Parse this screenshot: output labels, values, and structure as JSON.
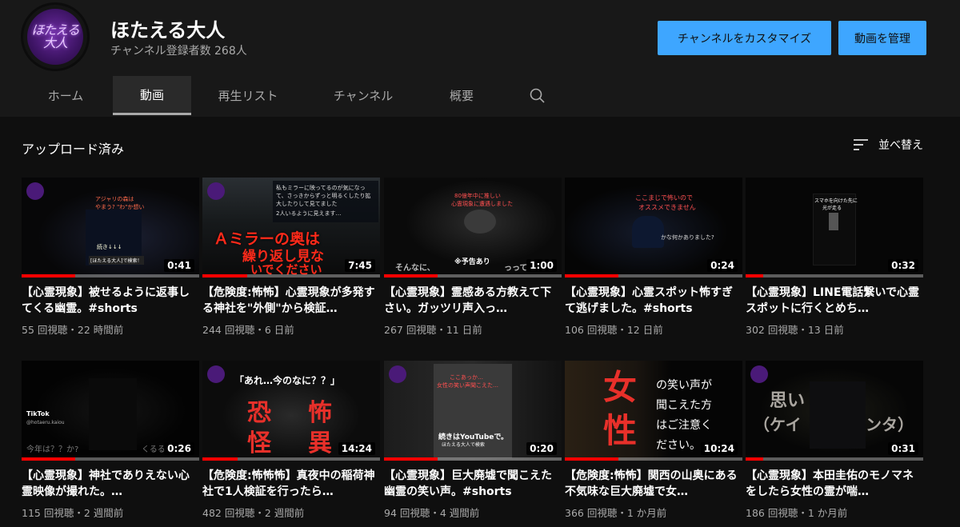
{
  "channel": {
    "avatar_text": "ほたえる大人",
    "name": "ほたえる大人",
    "subscribers": "チャンネル登録者数 268人"
  },
  "buttons": {
    "customize": "チャンネルをカスタマイズ",
    "manage": "動画を管理"
  },
  "tabs": [
    "ホーム",
    "動画",
    "再生リスト",
    "チャンネル",
    "概要"
  ],
  "active_tab": "動画",
  "section": {
    "title": "アップロード済み",
    "sort_label": "並べ替え"
  },
  "colors": {
    "accent": "#3ea6ff",
    "progress": "#ff0000",
    "background": "#0f0f0f",
    "header": "#181818"
  },
  "videos": [
    {
      "title": "【心霊現象】被せるように返事してくる幽霊。#shorts",
      "duration": "0:41",
      "meta": "55 回視聴・22 時間前",
      "progress": 0.3,
      "thumb_texts": [
        "アジャリの森は",
        "やまう? \"わ\"か想い",
        "続き↓↓↓",
        "[ほたえる大人]で検索！"
      ]
    },
    {
      "title": "【危険度:怖怖】心霊現象が多発する神社を\"外側\"から検証…",
      "duration": "7:45",
      "meta": "244 回視聴・6 日前",
      "progress": 0.25,
      "thumb_texts": [
        "私もミラーに映ってるのが気になって、さっきからずっと明るくしたり拡大したりして見てました",
        "2人いるように見えます…",
        "Ａミラーの奥は",
        "繰り返し見な",
        "いでください"
      ]
    },
    {
      "title": "【心霊現象】霊感ある方教えて下さい。ガッツリ声入っ…",
      "duration": "1:00",
      "meta": "267 回視聴・11 日前",
      "progress": 0.3,
      "thumb_texts": [
        "80億年中に推しい",
        "心霊現象に遭遇しました",
        "※予告あり",
        "そんなに、",
        "っって"
      ]
    },
    {
      "title": "【心霊現象】心霊スポット怖すぎて逃げました。#shorts",
      "duration": "0:24",
      "meta": "106 回視聴・12 日前",
      "progress": 0.3,
      "thumb_texts": [
        "ここまじで怖いので",
        "オススメできません",
        "かな何かありました?"
      ]
    },
    {
      "title": "【心霊現象】LINE電話繋いで心霊スポットに行くとめち…",
      "duration": "0:32",
      "meta": "302 回視聴・13 日前",
      "progress": 0.1,
      "thumb_texts": [
        "スマホを向けた先に",
        "光が走る"
      ]
    },
    {
      "title": "【心霊現象】神社でありえない心霊映像が撮れた。…",
      "duration": "0:26",
      "meta": "115 回視聴・2 週間前",
      "progress": 0.3,
      "thumb_texts": [
        "TikTok",
        "@hotaeru.kaiou",
        "今年は？？か?",
        "くるる"
      ]
    },
    {
      "title": "【危険度:怖怖怖】真夜中の稲荷神社で1人検証を行ったら…",
      "duration": "14:24",
      "meta": "482 回視聴・2 週間前",
      "progress": 0.2,
      "thumb_texts": [
        "「あれ…今のなに？？」",
        "恐",
        "怪",
        "怖",
        "異"
      ]
    },
    {
      "title": "【心霊現象】巨大廃墟で聞こえた幽霊の笑い声。#shorts",
      "duration": "0:20",
      "meta": "94 回視聴・4 週間前",
      "progress": 0.3,
      "thumb_texts": [
        "ここあっか…",
        "女性の笑い声聞こえた…",
        "続きはYouTubeで。",
        "ほたえる大人で検索"
      ]
    },
    {
      "title": "【危険度:怖怖】関西の山奥にある不気味な巨大廃墟で女…",
      "duration": "10:24",
      "meta": "366 回視聴・1 か月前",
      "progress": 0.3,
      "thumb_texts": [
        "女",
        "性",
        "の笑い声が",
        "聞こえた方",
        "はご注意く",
        "ださい。"
      ]
    },
    {
      "title": "【心霊現象】本田圭佑のモノマネをしたら女性の霊が喘…",
      "duration": "0:31",
      "meta": "186 回視聴・1 か月前",
      "progress": 0.1,
      "thumb_texts": [
        "思い",
        "（ケイ",
        "ンタ）"
      ]
    }
  ]
}
